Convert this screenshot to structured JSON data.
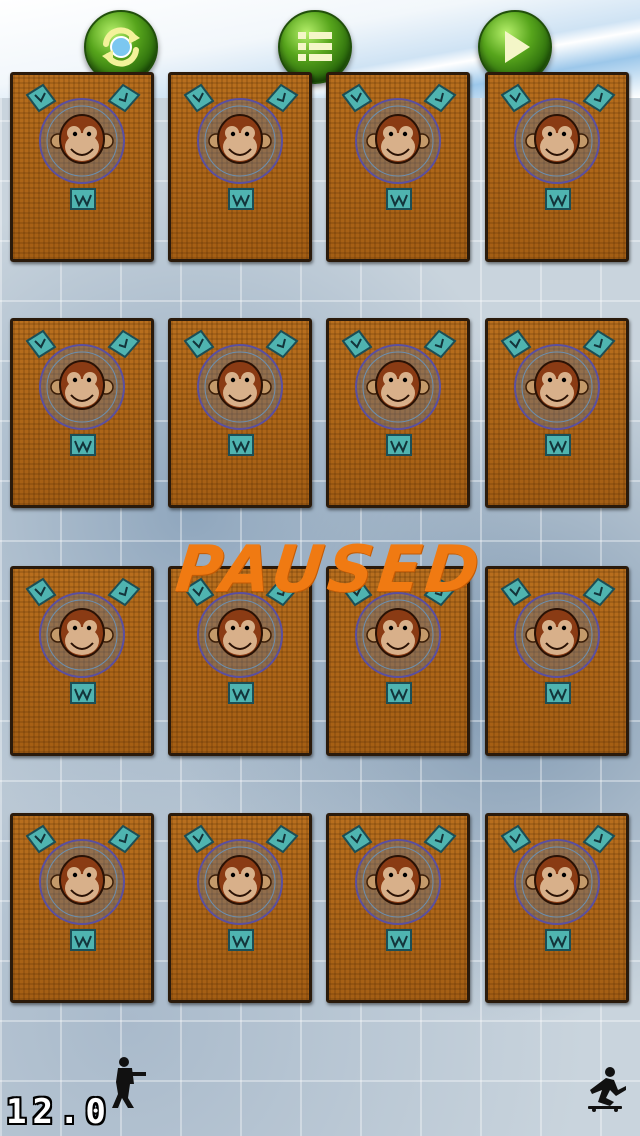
{
  "toolbar": {
    "restart_icon": "refresh-arrows-icon",
    "menu_icon": "list-icon",
    "play_icon": "play-icon",
    "button_color": "#57a51c"
  },
  "overlay": {
    "paused_label": "PAUSED",
    "label_color": "#f07a12"
  },
  "board": {
    "rows": 4,
    "columns": 4,
    "card_back": "monkey-card-back",
    "card_color": "#b86f1e"
  },
  "hud": {
    "timer": "12.0",
    "player_icon": "soldier-icon",
    "opponent_icon": "skater-icon"
  }
}
